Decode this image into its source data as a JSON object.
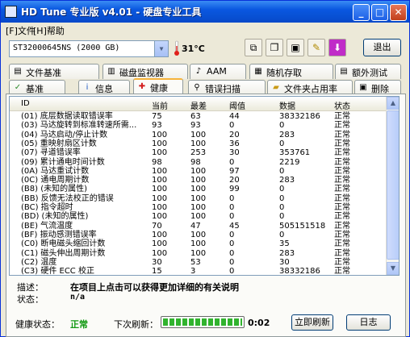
{
  "window": {
    "title": "HD Tune 专业版 v4.01 - 硬盘专业工具"
  },
  "menu": [
    {
      "label": "[F]文件"
    },
    {
      "label": "[H]帮助"
    }
  ],
  "toolbar": {
    "drive": "ST32000645NS (2000 GB)",
    "temperature": "31°C",
    "exit_label": "退出",
    "buttons": [
      "copy-icon",
      "copy-info-icon",
      "save-icon",
      "options-icon",
      "download-icon"
    ]
  },
  "tabs_top": [
    {
      "label": "文件基准",
      "icon": "file-benchmark-icon"
    },
    {
      "label": "磁盘监视器",
      "icon": "disk-monitor-icon"
    },
    {
      "label": "AAM",
      "icon": "aam-icon"
    },
    {
      "label": "随机存取",
      "icon": "random-access-icon"
    },
    {
      "label": "额外测试",
      "icon": "extra-tests-icon"
    }
  ],
  "tabs_bottom": [
    {
      "label": "基准",
      "icon": "benchmark-icon"
    },
    {
      "label": "信息",
      "icon": "info-icon"
    },
    {
      "label": "健康",
      "icon": "health-icon",
      "active": true
    },
    {
      "label": "错误扫描",
      "icon": "error-scan-icon"
    },
    {
      "label": "文件夹占用率",
      "icon": "folder-usage-icon"
    },
    {
      "label": "删除",
      "icon": "erase-icon"
    }
  ],
  "smart_table": {
    "columns": [
      "ID",
      "当前",
      "最差",
      "阈值",
      "数据",
      "状态"
    ],
    "rows": [
      {
        "id": "(01) 底层数据读取错误率",
        "current": "75",
        "worst": "63",
        "threshold": "44",
        "data": "38332186",
        "status": "正常"
      },
      {
        "id": "(03) 马达旋转到标准转速所需...",
        "current": "93",
        "worst": "93",
        "threshold": "0",
        "data": "0",
        "status": "正常"
      },
      {
        "id": "(04) 马达启动/停止计数",
        "current": "100",
        "worst": "100",
        "threshold": "20",
        "data": "283",
        "status": "正常"
      },
      {
        "id": "(05) 重映射扇区计数",
        "current": "100",
        "worst": "100",
        "threshold": "36",
        "data": "0",
        "status": "正常"
      },
      {
        "id": "(07) 寻道错误率",
        "current": "100",
        "worst": "253",
        "threshold": "30",
        "data": "353761",
        "status": "正常"
      },
      {
        "id": "(09) 累计通电时间计数",
        "current": "98",
        "worst": "98",
        "threshold": "0",
        "data": "2219",
        "status": "正常"
      },
      {
        "id": "(0A) 马达重试计数",
        "current": "100",
        "worst": "100",
        "threshold": "97",
        "data": "0",
        "status": "正常"
      },
      {
        "id": "(0C) 通电周期计数",
        "current": "100",
        "worst": "100",
        "threshold": "20",
        "data": "283",
        "status": "正常"
      },
      {
        "id": "(B8) (未知的属性)",
        "current": "100",
        "worst": "100",
        "threshold": "99",
        "data": "0",
        "status": "正常"
      },
      {
        "id": "(BB) 反馈无法校正的错误",
        "current": "100",
        "worst": "100",
        "threshold": "0",
        "data": "0",
        "status": "正常"
      },
      {
        "id": "(BC) 指令超时",
        "current": "100",
        "worst": "100",
        "threshold": "0",
        "data": "0",
        "status": "正常"
      },
      {
        "id": "(BD) (未知的属性)",
        "current": "100",
        "worst": "100",
        "threshold": "0",
        "data": "0",
        "status": "正常"
      },
      {
        "id": "(BE) 气流温度",
        "current": "70",
        "worst": "47",
        "threshold": "45",
        "data": "505151518",
        "status": "正常"
      },
      {
        "id": "(BF) 振动感测错误率",
        "current": "100",
        "worst": "100",
        "threshold": "0",
        "data": "0",
        "status": "正常"
      },
      {
        "id": "(C0) 断电磁头缩回计数",
        "current": "100",
        "worst": "100",
        "threshold": "0",
        "data": "35",
        "status": "正常"
      },
      {
        "id": "(C1) 磁头伸出周期计数",
        "current": "100",
        "worst": "100",
        "threshold": "0",
        "data": "283",
        "status": "正常"
      },
      {
        "id": "(C2) 温度",
        "current": "30",
        "worst": "53",
        "threshold": "0",
        "data": "30",
        "status": "正常"
      },
      {
        "id": "(C3) 硬件 ECC 校正",
        "current": "15",
        "worst": "3",
        "threshold": "0",
        "data": "38332186",
        "status": "正常"
      }
    ]
  },
  "description": {
    "label": "描述：",
    "text": "在项目上点击可以获得更加详细的有关说明"
  },
  "status": {
    "label": "状态：",
    "text": "n/a"
  },
  "footer": {
    "health_label": "健康状态：",
    "health_value": "正常",
    "next_refresh_label": "下次刷新：",
    "refresh_progress": 1.0,
    "countdown": "0:02",
    "refresh_button": "立即刷新",
    "log_button": "日志"
  }
}
